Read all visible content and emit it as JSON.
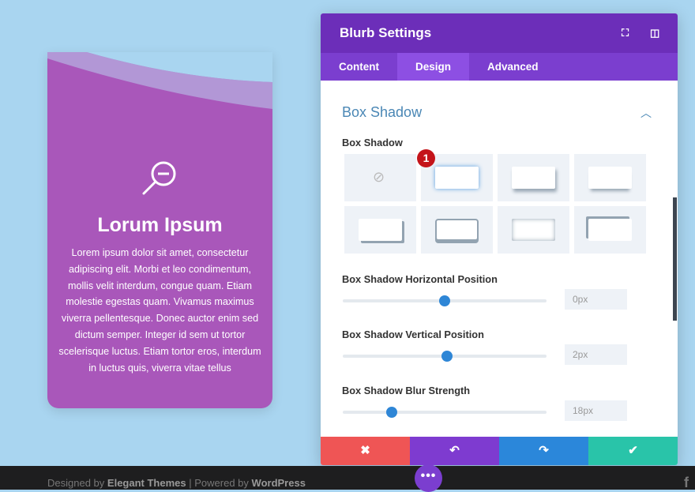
{
  "card": {
    "icon": "zoom-out-icon",
    "title": "Lorum Ipsum",
    "body": "Lorem ipsum dolor sit amet, consectetur adipiscing elit. Morbi et leo condimentum, mollis velit interdum, congue quam. Etiam molestie egestas quam. Vivamus maximus viverra pellentesque. Donec auctor enim sed dictum semper. Integer id sem ut tortor scelerisque luctus. Etiam tortor eros, interdum in luctus quis, viverra vitae tellus"
  },
  "panel": {
    "title": "Blurb Settings",
    "icons": [
      "fullscreen-icon",
      "sidebar-toggle-icon"
    ],
    "tabs": [
      {
        "label": "Content"
      },
      {
        "label": "Design",
        "active": true
      },
      {
        "label": "Advanced"
      }
    ],
    "section_title": "Box Shadow",
    "box_shadow_label": "Box Shadow",
    "badge": "1",
    "sliders": [
      {
        "label": "Box Shadow Horizontal Position",
        "value": "0px",
        "fraction": 0.5
      },
      {
        "label": "Box Shadow Vertical Position",
        "value": "2px",
        "fraction": 0.51
      },
      {
        "label": "Box Shadow Blur Strength",
        "value": "18px",
        "fraction": 0.24
      }
    ],
    "actions": [
      {
        "icon": "close-icon",
        "color": "#ef5555"
      },
      {
        "icon": "undo-icon",
        "color": "#7e3bd0"
      },
      {
        "icon": "redo-icon",
        "color": "#2b87da"
      },
      {
        "icon": "check-icon",
        "color": "#29c4a9"
      }
    ]
  },
  "footer": {
    "designed_by": "Designed by",
    "elegant": "Elegant Themes",
    "sep": "|",
    "powered_by": "Powered by",
    "wordpress": "WordPress",
    "more": "•••",
    "social": "f"
  }
}
